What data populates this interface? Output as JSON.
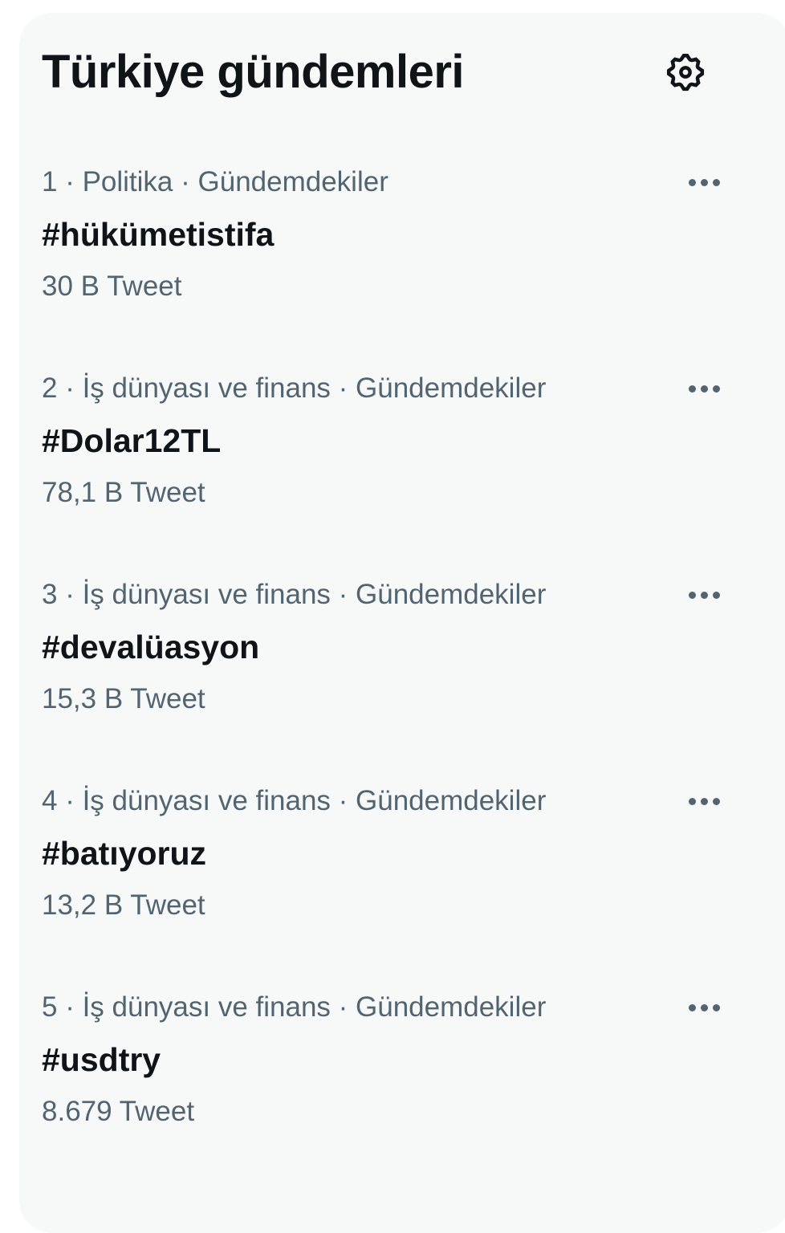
{
  "header": {
    "title": "Türkiye gündemleri",
    "settings_icon": "gear-icon"
  },
  "trends": [
    {
      "rank": "1",
      "category": "Politika",
      "context": "Gündemdekiler",
      "meta": "1 · Politika · Gündemdekiler",
      "hashtag": "#hükümetistifa",
      "count": "30 B Tweet"
    },
    {
      "rank": "2",
      "category": "İş dünyası ve finans",
      "context": "Gündemdekiler",
      "meta": "2 · İş dünyası ve finans · Gündemdekiler",
      "hashtag": "#Dolar12TL",
      "count": "78,1 B Tweet"
    },
    {
      "rank": "3",
      "category": "İş dünyası ve finans",
      "context": "Gündemdekiler",
      "meta": "3 · İş dünyası ve finans · Gündemdekiler",
      "hashtag": "#devalüasyon",
      "count": "15,3 B Tweet"
    },
    {
      "rank": "4",
      "category": "İş dünyası ve finans",
      "context": "Gündemdekiler",
      "meta": "4 · İş dünyası ve finans · Gündemdekiler",
      "hashtag": "#batıyoruz",
      "count": "13,2 B Tweet"
    },
    {
      "rank": "5",
      "category": "İş dünyası ve finans",
      "context": "Gündemdekiler",
      "meta": "5 · İş dünyası ve finans · Gündemdekiler",
      "hashtag": "#usdtry",
      "count": "8.679 Tweet"
    }
  ],
  "colors": {
    "panel_background": "#f7f9f9",
    "primary_text": "#0f1419",
    "secondary_text": "#536471"
  },
  "icons": {
    "more": "more-horizontal-icon",
    "settings": "gear-icon"
  }
}
